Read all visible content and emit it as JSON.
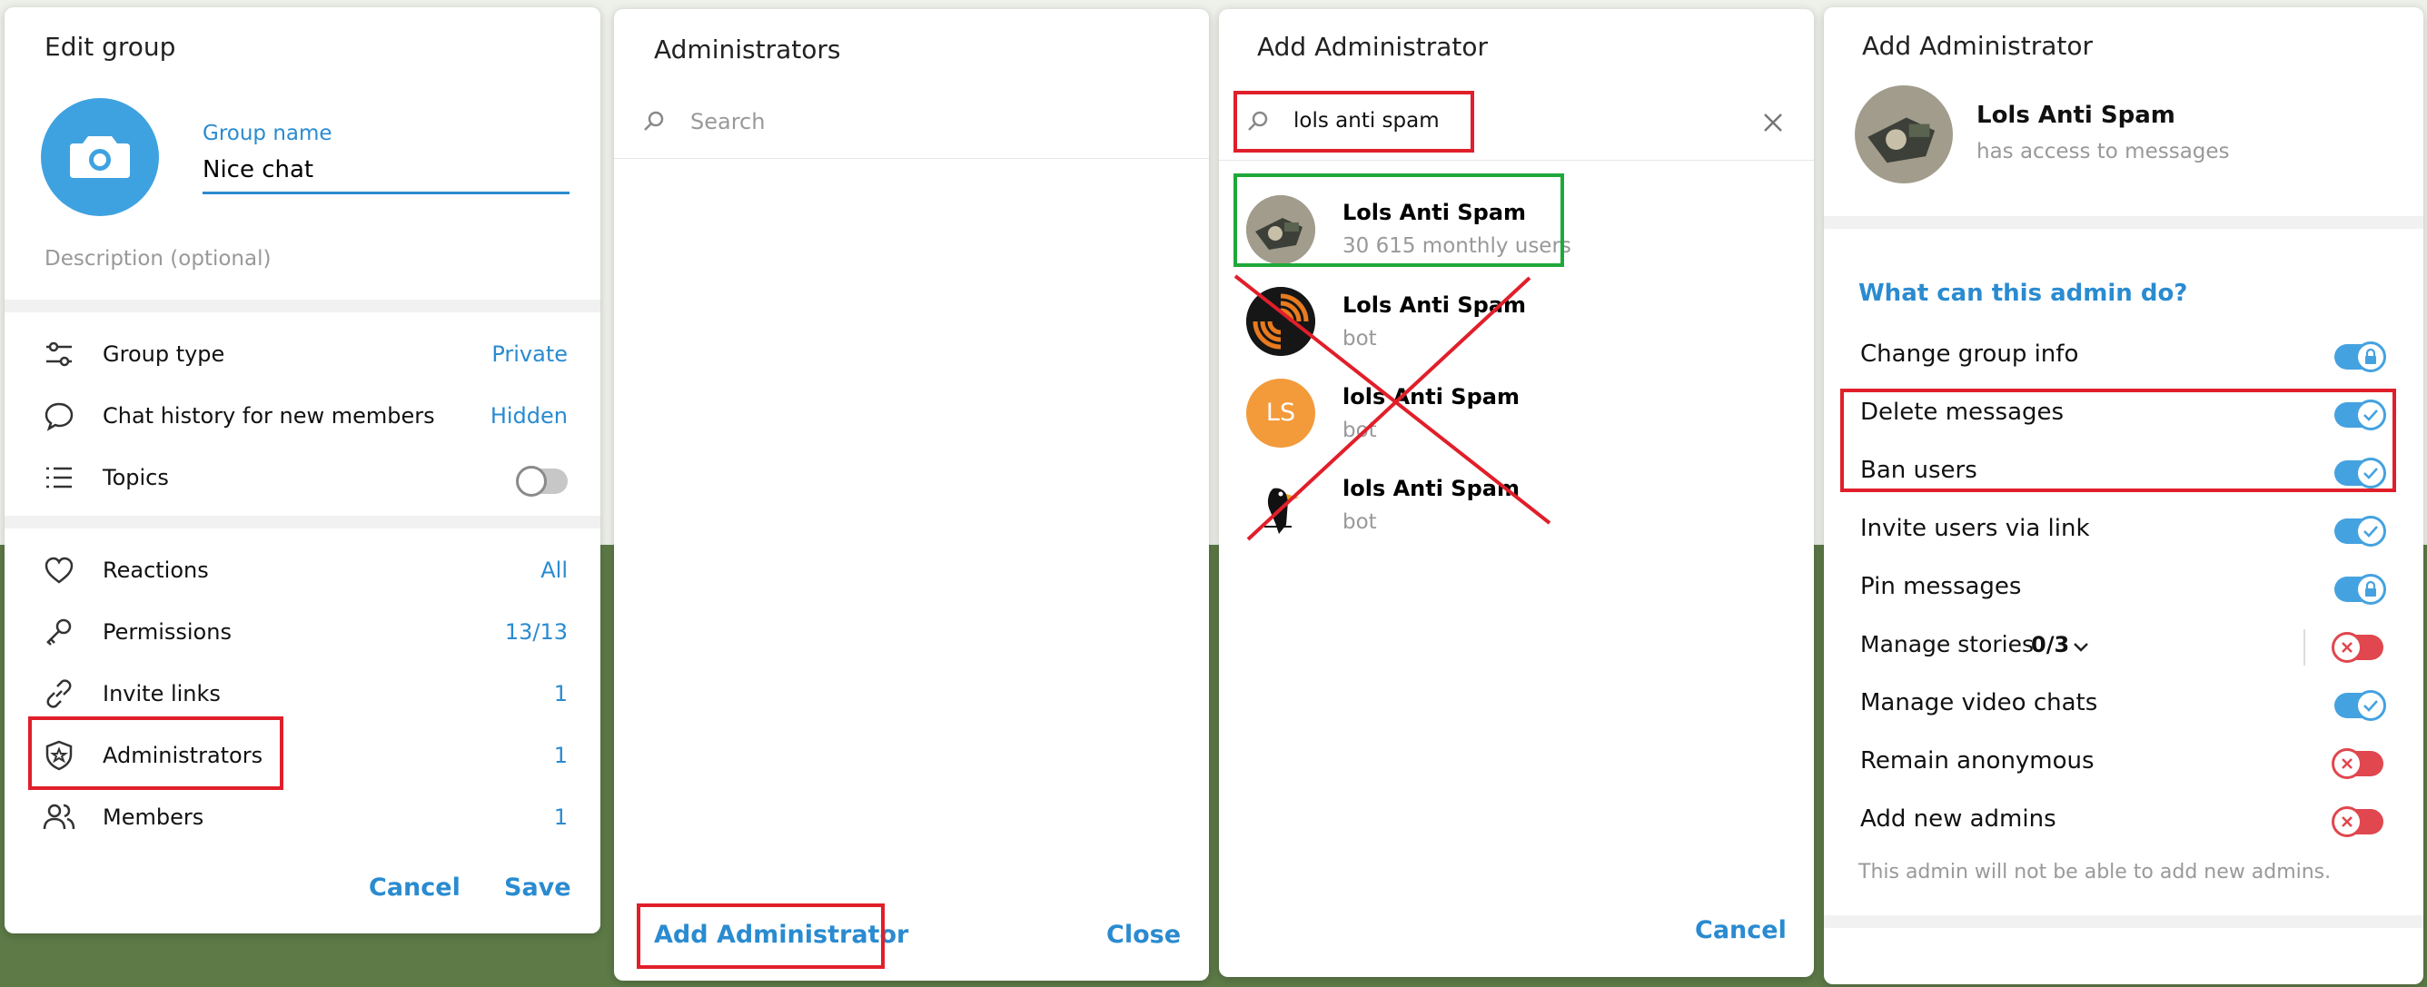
{
  "edit_group": {
    "title": "Edit group",
    "group_name_label": "Group name",
    "group_name_value": "Nice chat",
    "description_placeholder": "Description (optional)",
    "rows": [
      {
        "label": "Group type",
        "value": "Private",
        "icon": "sliders-icon"
      },
      {
        "label": "Chat history for new members",
        "value": "Hidden",
        "icon": "chat-bubble-icon"
      },
      {
        "label": "Topics",
        "value": "",
        "icon": "list-icon"
      },
      {
        "label": "Reactions",
        "value": "All",
        "icon": "heart-icon"
      },
      {
        "label": "Permissions",
        "value": "13/13",
        "icon": "key-icon"
      },
      {
        "label": "Invite links",
        "value": "1",
        "icon": "link-icon"
      },
      {
        "label": "Administrators",
        "value": "1",
        "icon": "shield-star-icon"
      },
      {
        "label": "Members",
        "value": "1",
        "icon": "people-icon"
      }
    ],
    "topics_enabled": false,
    "cancel_label": "Cancel",
    "save_label": "Save"
  },
  "administrators": {
    "title": "Administrators",
    "search_placeholder": "Search",
    "add_label": "Add Administrator",
    "close_label": "Close"
  },
  "add_admin_search": {
    "title": "Add Administrator",
    "search_value": "lols anti spam",
    "results": [
      {
        "name": "Lols Anti Spam",
        "sub": "30 615 monthly users",
        "avatar": "photo"
      },
      {
        "name": "Lols Anti Spam",
        "sub": "bot",
        "avatar": "spiral"
      },
      {
        "name": "lols Anti Spam",
        "sub": "bot",
        "avatar": "initials",
        "initials": "LS"
      },
      {
        "name": "lols Anti Spam",
        "sub": "bot",
        "avatar": "bird"
      }
    ],
    "cancel_label": "Cancel"
  },
  "add_admin_rights": {
    "title": "Add Administrator",
    "bot_name": "Lols Anti Spam",
    "bot_status": "has access to messages",
    "section_title": "What can this admin do?",
    "permissions": [
      {
        "label": "Change group info",
        "state": "locked-on"
      },
      {
        "label": "Delete messages",
        "state": "on"
      },
      {
        "label": "Ban users",
        "state": "on"
      },
      {
        "label": "Invite users via link",
        "state": "on"
      },
      {
        "label": "Pin messages",
        "state": "locked-on"
      },
      {
        "label": "Manage stories",
        "state": "off",
        "count": "0/3"
      },
      {
        "label": "Manage video chats",
        "state": "on"
      },
      {
        "label": "Remain anonymous",
        "state": "off"
      },
      {
        "label": "Add new admins",
        "state": "off"
      }
    ],
    "footer_note": "This admin will not be able to add new admins."
  },
  "colors": {
    "accent": "#2a8bd0",
    "highlight_red": "#e01f2a",
    "highlight_green": "#1fa83a",
    "toggle_on": "#44a2e0",
    "toggle_off": "#e0474e"
  }
}
